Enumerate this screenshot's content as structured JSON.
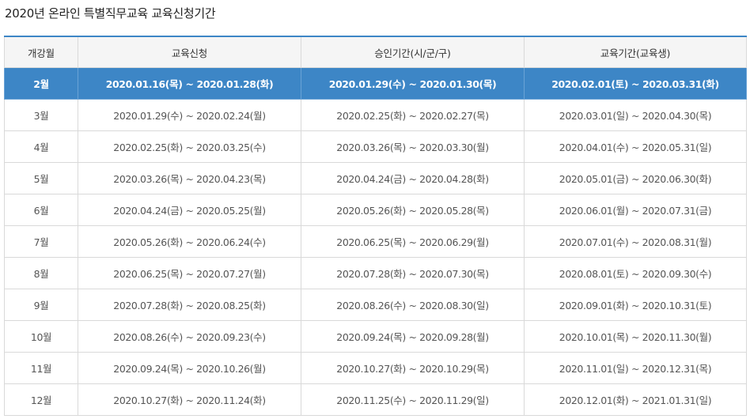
{
  "title": "2020년 온라인 특별직무교육 교육신청기간",
  "table": {
    "headers": [
      "개강월",
      "교육신청",
      "승인기간(시/군/구)",
      "교육기간(교육생)"
    ],
    "rows": [
      {
        "month": "2월",
        "apply": "2020.01.16(목) ~ 2020.01.28(화)",
        "approve": "2020.01.29(수) ~ 2020.01.30(목)",
        "education": "2020.02.01(토) ~ 2020.03.31(화)",
        "highlighted": true
      },
      {
        "month": "3월",
        "apply": "2020.01.29(수) ~ 2020.02.24(월)",
        "approve": "2020.02.25(화) ~ 2020.02.27(목)",
        "education": "2020.03.01(일) ~ 2020.04.30(목)",
        "highlighted": false
      },
      {
        "month": "4월",
        "apply": "2020.02.25(화) ~ 2020.03.25(수)",
        "approve": "2020.03.26(목) ~ 2020.03.30(월)",
        "education": "2020.04.01(수) ~ 2020.05.31(일)",
        "highlighted": false
      },
      {
        "month": "5월",
        "apply": "2020.03.26(목) ~ 2020.04.23(목)",
        "approve": "2020.04.24(금) ~ 2020.04.28(화)",
        "education": "2020.05.01(금) ~ 2020.06.30(화)",
        "highlighted": false
      },
      {
        "month": "6월",
        "apply": "2020.04.24(금) ~ 2020.05.25(월)",
        "approve": "2020.05.26(화) ~ 2020.05.28(목)",
        "education": "2020.06.01(월) ~ 2020.07.31(금)",
        "highlighted": false
      },
      {
        "month": "7월",
        "apply": "2020.05.26(화) ~ 2020.06.24(수)",
        "approve": "2020.06.25(목) ~ 2020.06.29(월)",
        "education": "2020.07.01(수) ~ 2020.08.31(월)",
        "highlighted": false
      },
      {
        "month": "8월",
        "apply": "2020.06.25(목) ~ 2020.07.27(월)",
        "approve": "2020.07.28(화) ~ 2020.07.30(목)",
        "education": "2020.08.01(토) ~ 2020.09.30(수)",
        "highlighted": false
      },
      {
        "month": "9월",
        "apply": "2020.07.28(화) ~ 2020.08.25(화)",
        "approve": "2020.08.26(수) ~ 2020.08.30(일)",
        "education": "2020.09.01(화) ~ 2020.10.31(토)",
        "highlighted": false
      },
      {
        "month": "10월",
        "apply": "2020.08.26(수) ~ 2020.09.23(수)",
        "approve": "2020.09.24(목) ~ 2020.09.28(월)",
        "education": "2020.10.01(목) ~ 2020.11.30(월)",
        "highlighted": false
      },
      {
        "month": "11월",
        "apply": "2020.09.24(목) ~ 2020.10.26(월)",
        "approve": "2020.10.27(화) ~ 2020.10.29(목)",
        "education": "2020.11.01(일) ~ 2020.12.31(목)",
        "highlighted": false
      },
      {
        "month": "12월",
        "apply": "2020.10.27(화) ~ 2020.11.24(화)",
        "approve": "2020.11.25(수) ~ 2020.11.29(일)",
        "education": "2020.12.01(화) ~ 2021.01.31(일)",
        "highlighted": false
      }
    ]
  },
  "colors": {
    "accent": "#3d86c6",
    "header_bg": "#f5f5f5",
    "border": "#d9d9d9"
  }
}
